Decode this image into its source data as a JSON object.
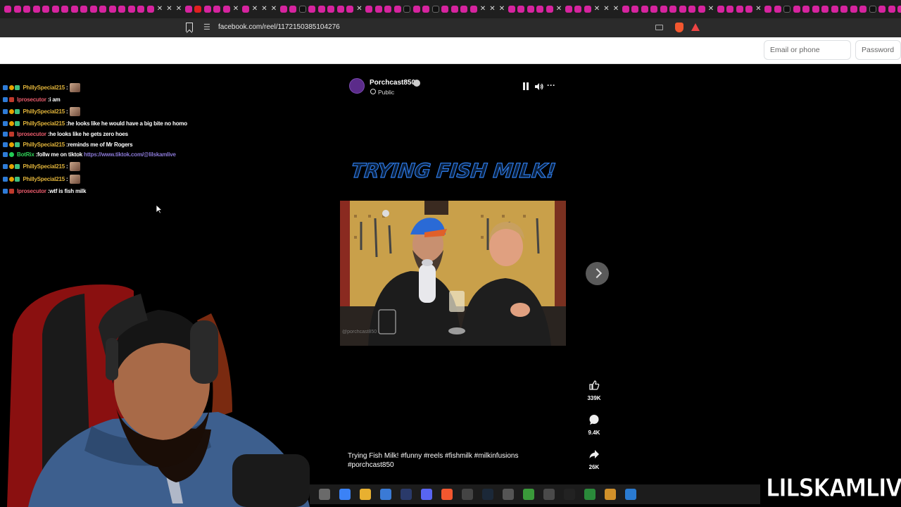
{
  "browser": {
    "tab_icons": [
      "ig",
      "ig",
      "ig",
      "ig",
      "ig",
      "ig",
      "ig",
      "ig",
      "ig",
      "ig",
      "ig",
      "ig",
      "ig",
      "ig",
      "ig",
      "ig",
      "x",
      "x",
      "x",
      "ig",
      "yt",
      "ig",
      "ig",
      "ig",
      "x",
      "ig",
      "x",
      "x",
      "x",
      "ig",
      "ig",
      "tt",
      "ig",
      "ig",
      "ig",
      "ig",
      "ig",
      "x",
      "ig",
      "ig",
      "ig",
      "ig",
      "tt",
      "ig",
      "ig",
      "tt",
      "ig",
      "ig",
      "ig",
      "ig",
      "x",
      "x",
      "x",
      "ig",
      "ig",
      "ig",
      "ig",
      "ig",
      "x",
      "ig",
      "ig",
      "ig",
      "x",
      "x",
      "x",
      "ig",
      "ig",
      "ig",
      "ig",
      "ig",
      "ig",
      "ig",
      "ig",
      "ig",
      "x",
      "ig",
      "ig",
      "ig",
      "ig",
      "x",
      "ig",
      "ig",
      "tt",
      "ig",
      "ig",
      "ig",
      "ig",
      "ig",
      "ig",
      "ig",
      "ig",
      "tt",
      "ig",
      "ig",
      "ig",
      "ig"
    ],
    "url": "facebook.com/reel/1172150385104276",
    "icons": [
      "bookmark-icon",
      "site-settings-icon",
      "cast-icon",
      "brave-shield-icon",
      "brave-rewards-icon"
    ]
  },
  "facebook_header": {
    "email_placeholder": "Email or phone",
    "password_placeholder": "Password"
  },
  "chat": {
    "messages": [
      {
        "user": "PhillySpecial215",
        "user_class": "u-philly",
        "text": "",
        "emote": true,
        "badges": [
          "blue",
          "gold",
          "green"
        ]
      },
      {
        "user": "lprosecutor",
        "user_class": "u-prosecutor",
        "text": "i am",
        "emote": false,
        "badges": [
          "blue",
          "red"
        ]
      },
      {
        "user": "PhillySpecial215",
        "user_class": "u-philly",
        "text": "",
        "emote": true,
        "badges": [
          "blue",
          "gold",
          "green"
        ]
      },
      {
        "user": "PhillySpecial215",
        "user_class": "u-philly",
        "text": "he looks like he would have a big bite no homo",
        "emote": false,
        "badges": [
          "blue",
          "gold",
          "green"
        ]
      },
      {
        "user": "lprosecutor",
        "user_class": "u-prosecutor",
        "text": "he looks like he gets zero hoes",
        "emote": false,
        "badges": [
          "blue",
          "red"
        ]
      },
      {
        "user": "PhillySpecial215",
        "user_class": "u-philly",
        "text": "reminds me of Mr Rogers",
        "emote": false,
        "badges": [
          "blue",
          "gold",
          "green"
        ]
      },
      {
        "user": "BotRix",
        "user_class": "u-botrix",
        "text": "follw me on tiktok",
        "link": "https://www.tiktok.com/@lilskamlive",
        "emote": false,
        "badges": [
          "blue",
          "lime"
        ]
      },
      {
        "user": "PhillySpecial215",
        "user_class": "u-philly",
        "text": "",
        "emote": true,
        "badges": [
          "blue",
          "gold",
          "green"
        ]
      },
      {
        "user": "PhillySpecial215",
        "user_class": "u-philly",
        "text": "",
        "emote": true,
        "badges": [
          "blue",
          "gold",
          "green"
        ]
      },
      {
        "user": "lprosecutor",
        "user_class": "u-prosecutor",
        "text": "wtf is fish milk",
        "emote": false,
        "badges": [
          "blue",
          "red"
        ]
      }
    ]
  },
  "reel": {
    "author": "Porchcast850",
    "privacy": "Public",
    "title_overlay": "TRYING FISH MILK!",
    "likes": "339K",
    "comments": "9.4K",
    "shares": "26K",
    "caption": "Trying Fish Milk!  #funny #reels #fishmilk #milkinfusions #porchcast850",
    "video_watermark": "@porchcast850"
  },
  "taskbar": {
    "apps": [
      "file-explorer",
      "copilot",
      "folder",
      "store",
      "photoshop",
      "discord",
      "brave",
      "obs",
      "steam",
      "app",
      "app",
      "4k-video",
      "app",
      "app",
      "app",
      "app"
    ]
  },
  "stream_watermark": "LILSKAMLIVE",
  "colors": {
    "accent_title": "#2d7be8",
    "chat_user_philly": "#e0b33a",
    "chat_user_prosecutor": "#e75a6a",
    "chat_user_botrix": "#30d158"
  }
}
